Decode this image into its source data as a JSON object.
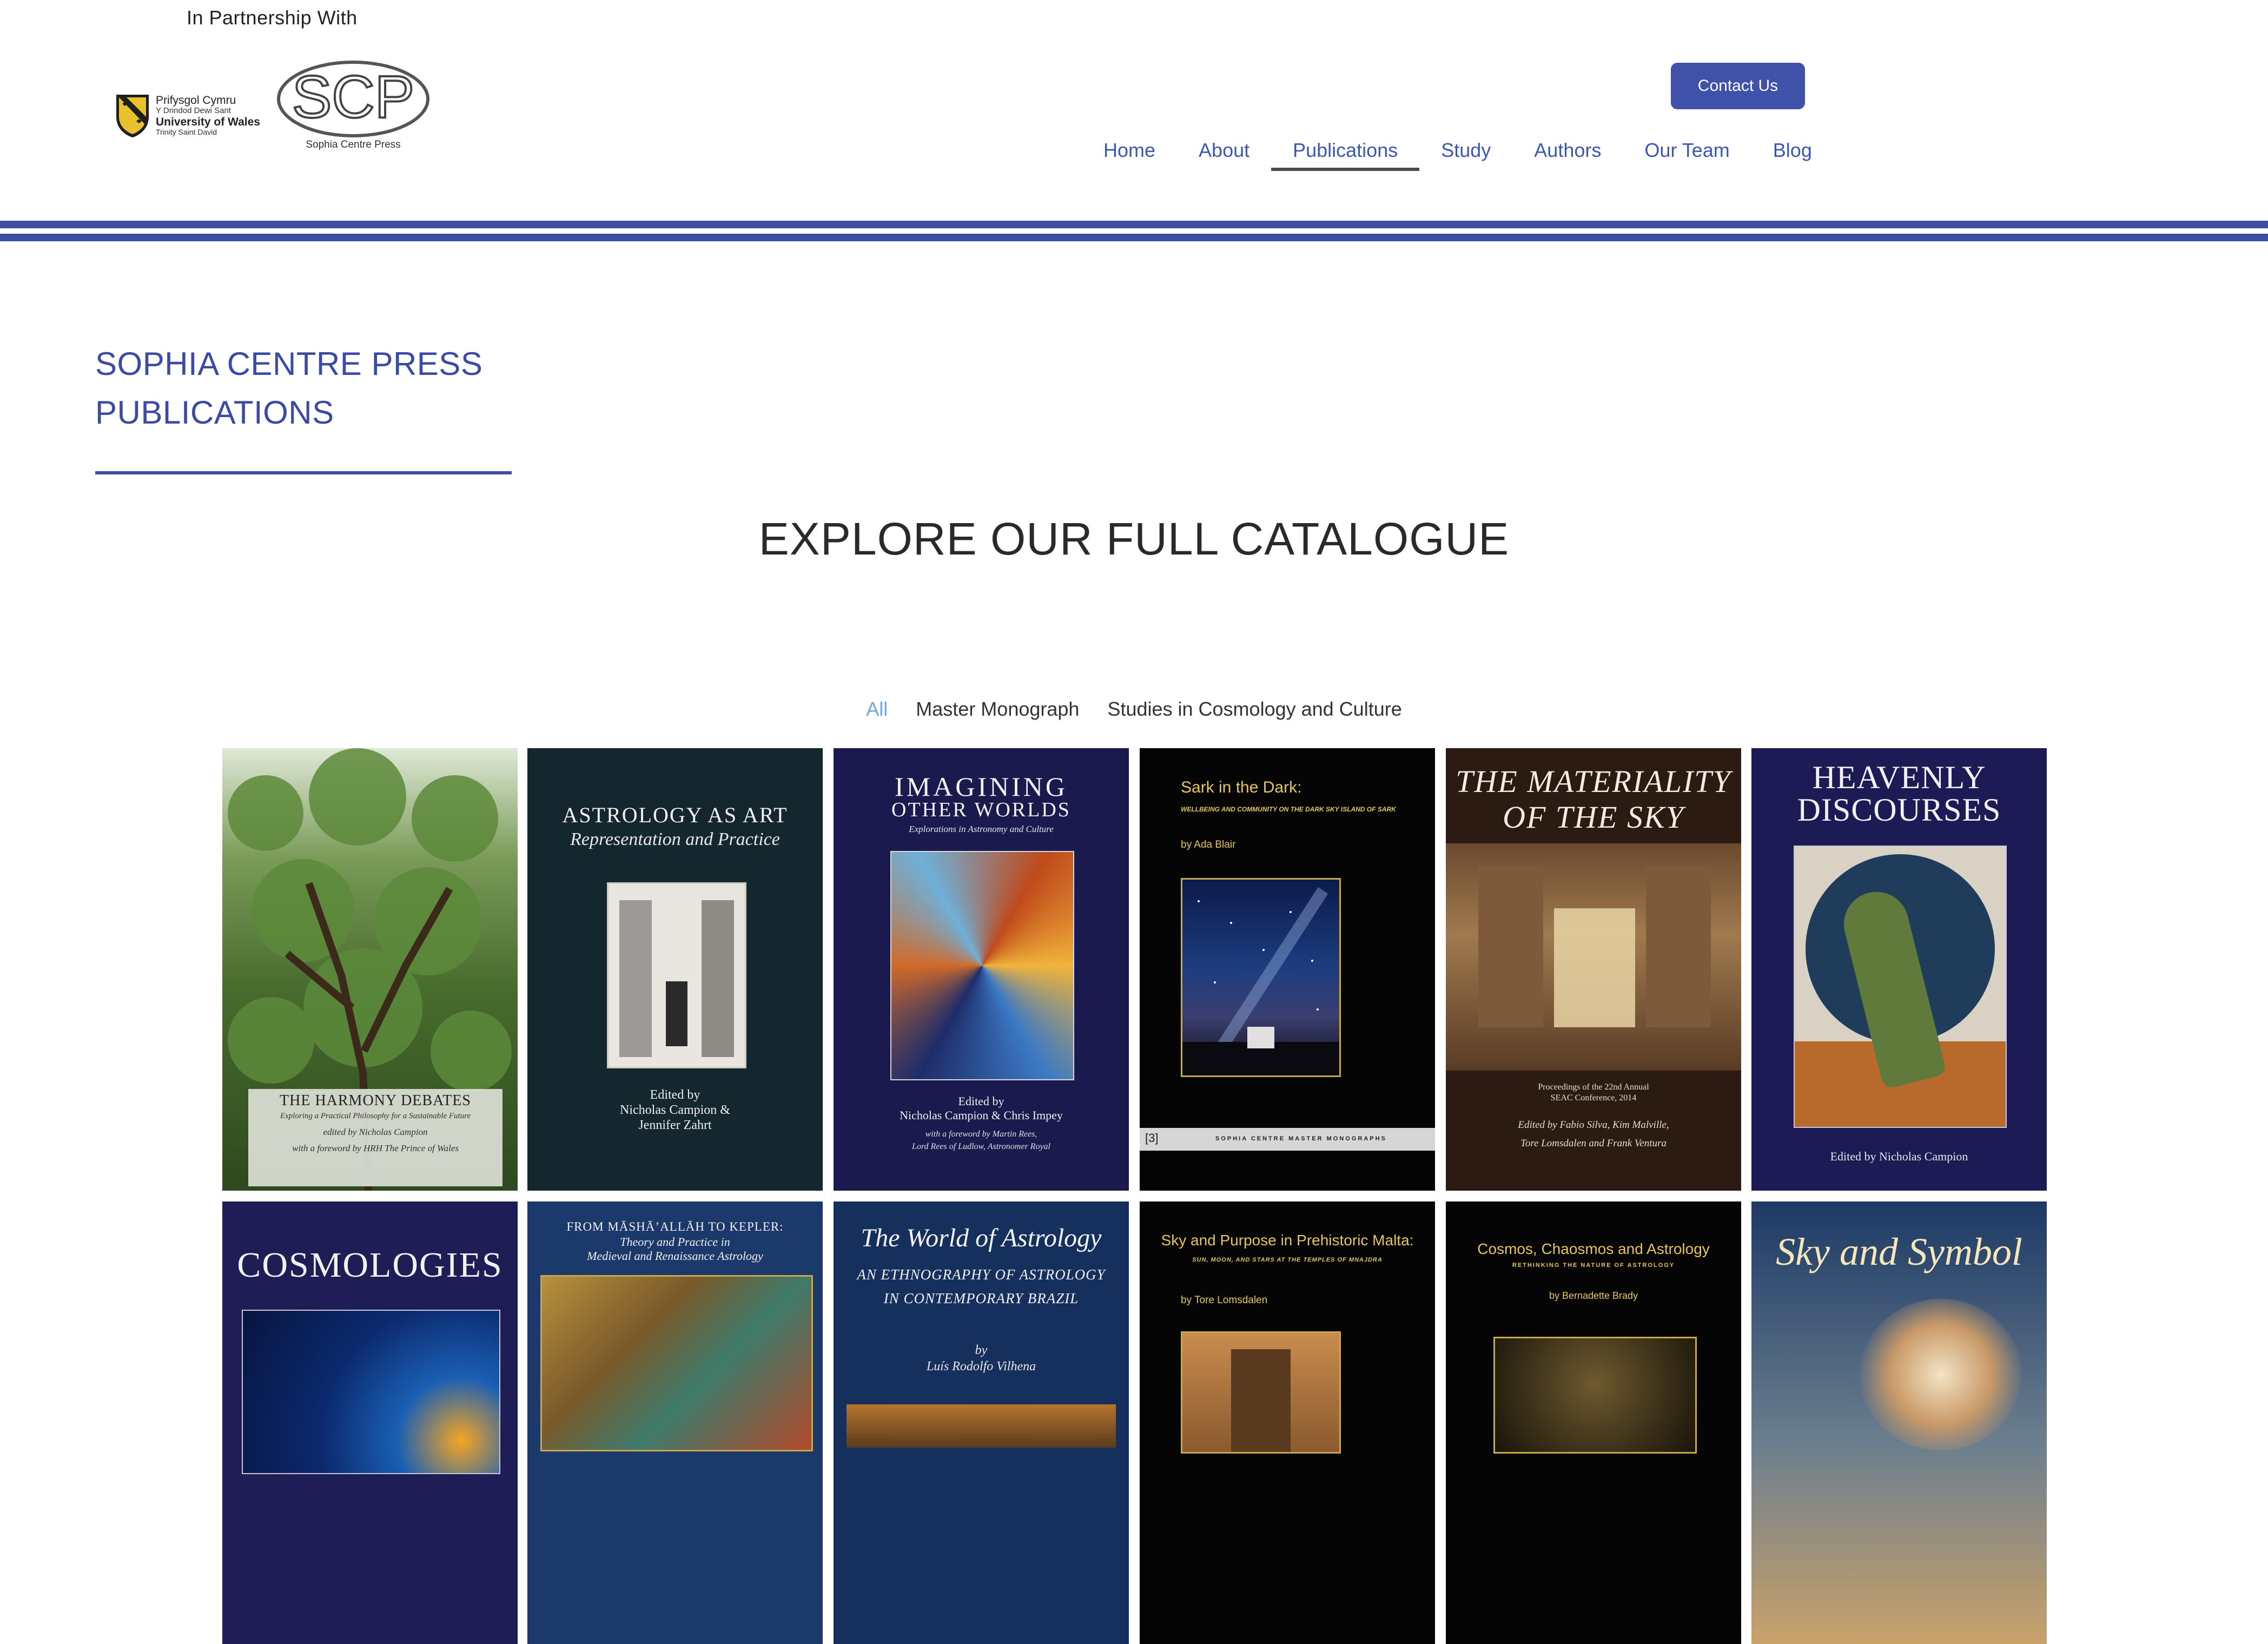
{
  "header": {
    "partnership": "In Partnership With",
    "uw_logo": {
      "line1": "Prifysgol Cymru",
      "line2": "Y Drindod Dewi Sant",
      "line3": "University of Wales",
      "line4": "Trinity Saint David"
    },
    "scp_logo": {
      "mark": "SCP",
      "caption": "Sophia Centre Press"
    },
    "contact_label": "Contact Us",
    "nav": [
      {
        "label": "Home"
      },
      {
        "label": "About"
      },
      {
        "label": "Publications",
        "active": true
      },
      {
        "label": "Study"
      },
      {
        "label": "Authors"
      },
      {
        "label": "Our Team"
      },
      {
        "label": "Blog"
      }
    ]
  },
  "colors": {
    "brand_blue": "#3d4fa0",
    "nav_link": "#3b57b5",
    "filter_active": "#6fa8e0"
  },
  "main": {
    "heading_line1": "SOPHIA CENTRE PRESS",
    "heading_line2": "PUBLICATIONS",
    "explore": "EXPLORE OUR FULL CATALOGUE",
    "filters": [
      {
        "label": "All",
        "active": true
      },
      {
        "label": "Master Monograph"
      },
      {
        "label": "Studies in Cosmology and Culture"
      }
    ]
  },
  "books": [
    {
      "title": "THE HARMONY DEBATES",
      "subtitle": "Exploring a Practical Philosophy for a Sustainable Future",
      "editor": "edited by Nicholas Campion",
      "extra": "with a foreword by HRH The Prince of Wales"
    },
    {
      "title": "ASTROLOGY AS ART",
      "subtitle": "Representation and Practice",
      "editor": "Edited by",
      "extra": "Nicholas Campion &",
      "extra2": "Jennifer Zahrt"
    },
    {
      "title": "IMAGINING",
      "title2": "OTHER WORLDS",
      "subtitle": "Explorations in Astronomy and Culture",
      "editor": "Edited by",
      "extra": "Nicholas Campion & Chris Impey",
      "extra2": "with a foreword by Martin Rees,",
      "extra3": "Lord Rees of Ludlow, Astronomer Royal"
    },
    {
      "title": "Sark in the Dark:",
      "subtitle": "WELLBEING AND COMMUNITY ON THE DARK SKY ISLAND OF SARK",
      "editor": "by Ada Blair",
      "series_no": "[3]",
      "series": "SOPHIA CENTRE MASTER MONOGRAPHS"
    },
    {
      "title": "THE MATERIALITY",
      "title2": "OF THE SKY",
      "subtitle": "Proceedings of the 22nd Annual",
      "subtitle2": "SEAC Conference, 2014",
      "editor": "Edited by Fabio Silva, Kim Malville,",
      "extra": "Tore Lomsdalen and Frank Ventura"
    },
    {
      "title": "HEAVENLY",
      "title2": "DISCOURSES",
      "editor": "Edited by Nicholas Campion"
    },
    {
      "title": "COSMOLOGIES"
    },
    {
      "title": "FROM MĀSHĀ’ALLĀH TO KEPLER:",
      "subtitle": "Theory and Practice in",
      "subtitle2": "Medieval and Renaissance Astrology"
    },
    {
      "title": "The World of Astrology",
      "subtitle": "AN ETHNOGRAPHY OF ASTROLOGY",
      "subtitle2": "IN CONTEMPORARY BRAZIL",
      "editor": "by",
      "extra": "Luís Rodolfo Vilhena"
    },
    {
      "title": "Sky and Purpose in Prehistoric Malta:",
      "subtitle": "SUN, MOON, AND STARS AT THE TEMPLES OF MNAJDRA",
      "editor": "by Tore Lomsdalen"
    },
    {
      "title": "Cosmos, Chaosmos and Astrology",
      "subtitle": "RETHINKING THE NATURE OF ASTROLOGY",
      "editor": "by Bernadette Brady"
    },
    {
      "title": "Sky and Symbol"
    }
  ]
}
